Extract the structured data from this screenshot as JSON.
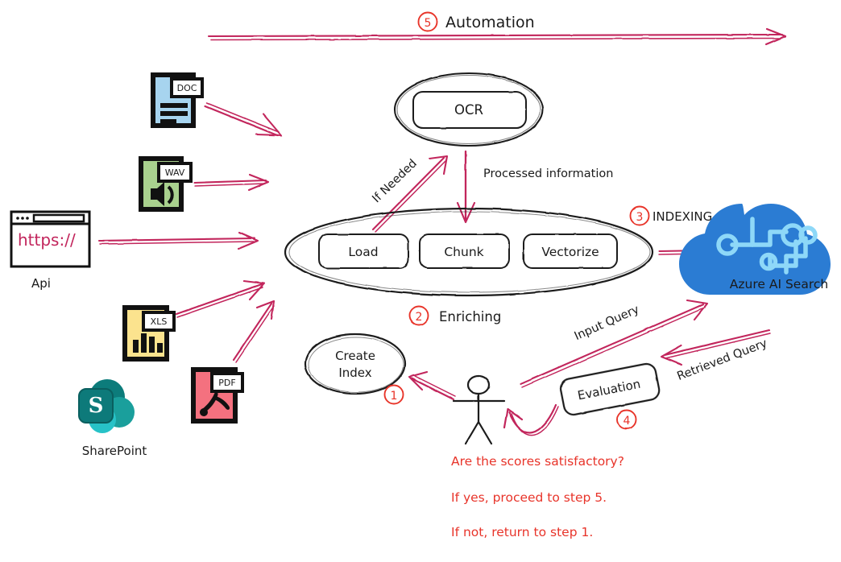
{
  "diagram": {
    "title_flow": "Azure AI Search RAG ingestion and evaluation pipeline",
    "top_step": {
      "number": "5",
      "label": "Automation"
    },
    "sources": [
      {
        "id": "doc",
        "badge": "DOC",
        "label": "",
        "color": "#a7d4ef"
      },
      {
        "id": "wav",
        "badge": "WAV",
        "label": "",
        "color": "#a9d18e"
      },
      {
        "id": "api",
        "badge": "https://",
        "label": "Api",
        "color": "#ffffff"
      },
      {
        "id": "xls",
        "badge": "XLS",
        "label": "",
        "color": "#fbe38e"
      },
      {
        "id": "pdf",
        "badge": "PDF",
        "label": "",
        "color": "#f4717f"
      },
      {
        "id": "sharepoint",
        "badge": "S",
        "label": "SharePoint",
        "color": "#0e7c7b"
      }
    ],
    "ocr": {
      "box_label": "OCR",
      "incoming_label": "If Needed",
      "outgoing_label": "Processed information"
    },
    "enrichment": {
      "stages": [
        "Load",
        "Chunk",
        "Vectorize"
      ],
      "step_number": "2",
      "step_label": "Enriching"
    },
    "indexing": {
      "step_number": "3",
      "step_label": "INDEXING"
    },
    "azure": {
      "label": "Azure AI Search",
      "cloud_color": "#2b7cd3",
      "node_color": "#8ed8f8"
    },
    "create_index": {
      "line1": "Create",
      "line2": "Index",
      "step_number": "1"
    },
    "evaluation": {
      "label": "Evaluation",
      "step_number": "4"
    },
    "query_labels": {
      "input": "Input Query",
      "retrieved": "Retrieved Query"
    },
    "notes": [
      "Are the scores satisfactory?",
      "If yes, proceed to step 5.",
      "If not, return to step 1."
    ],
    "colors": {
      "arrow": "#c2255c",
      "annotation": "#e8342a",
      "ink": "#1b1b1b"
    }
  }
}
